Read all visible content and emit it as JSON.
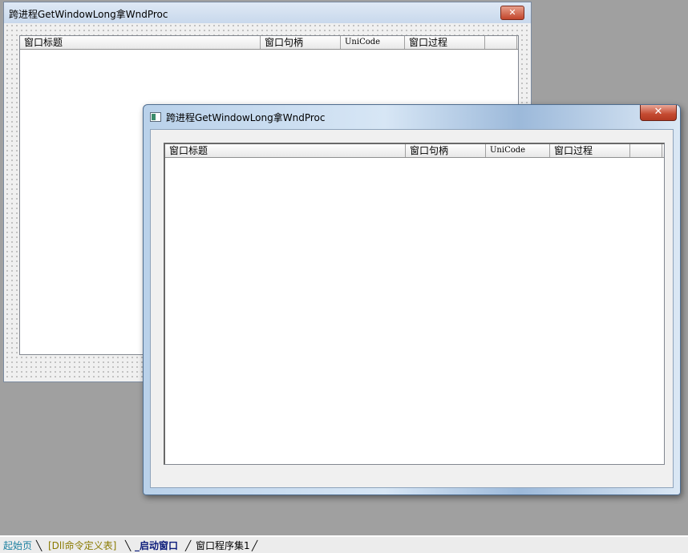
{
  "design_form": {
    "title": "跨进程GetWindowLong拿WndProc",
    "close_glyph": "✕",
    "columns": [
      "窗口标题",
      "窗口句柄",
      "UniCode",
      "窗口过程"
    ]
  },
  "run_window": {
    "title": "跨进程GetWindowLong拿WndProc",
    "close_glyph": "✕",
    "columns": [
      "窗口标题",
      "窗口句柄",
      "UniCode",
      "窗口过程"
    ]
  },
  "tabs": [
    {
      "label": "起始页",
      "color": "#1a7fa0"
    },
    {
      "label": "[Dll命令定义表]",
      "color": "#8a7a00"
    },
    {
      "label": "_启动窗口",
      "color": "#0a1a7a"
    },
    {
      "label": "窗口程序集1",
      "color": "#000000"
    }
  ],
  "colors": {
    "desktop": "#a0a0a0",
    "close_button": "#c44a31"
  }
}
